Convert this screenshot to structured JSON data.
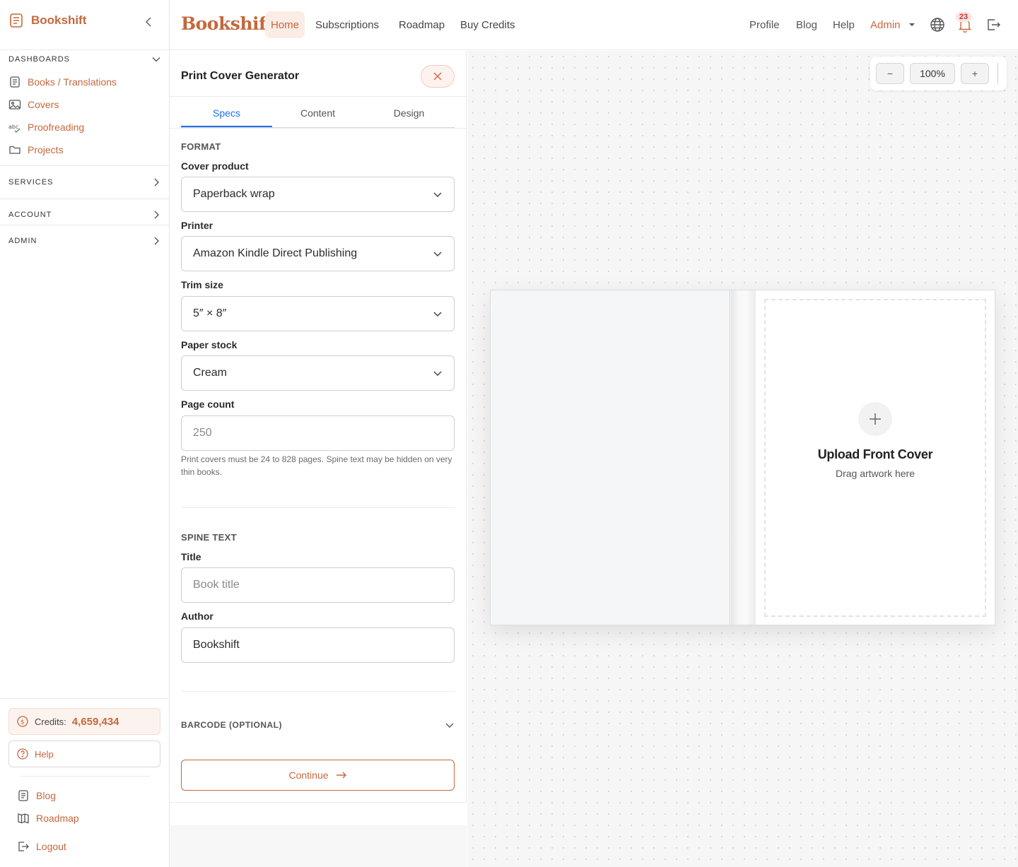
{
  "sidebar": {
    "brand": "Bookshift",
    "sections": {
      "dashboards": "DASHBOARDS",
      "services": "SERVICES",
      "account": "ACCOUNT",
      "admin": "ADMIN"
    },
    "items": [
      {
        "label": "Books / Translations",
        "icon": "book-list-icon"
      },
      {
        "label": "Covers",
        "icon": "image-icon"
      },
      {
        "label": "Proofreading",
        "icon": "spellcheck-icon"
      },
      {
        "label": "Projects",
        "icon": "folder-icon"
      }
    ],
    "credits_label": "Credits:",
    "credits_value": "4,659,434",
    "help_label": "Help",
    "bottom_links": [
      {
        "label": "Blog",
        "icon": "document-icon"
      },
      {
        "label": "Roadmap",
        "icon": "map-icon"
      },
      {
        "label": "Logout",
        "icon": "logout-icon"
      }
    ]
  },
  "topbar": {
    "brand": "Bookshift",
    "nav": [
      "Home",
      "Subscriptions",
      "Roadmap",
      "Buy Credits"
    ],
    "right": [
      "Profile",
      "Blog",
      "Help",
      "Admin"
    ],
    "notification_count": "23",
    "accent": "#c4683c"
  },
  "panel": {
    "title": "Print Cover Generator",
    "tabs": [
      "Specs",
      "Content",
      "Design"
    ],
    "active_tab": "Specs",
    "format_title": "FORMAT",
    "cover_product": {
      "label": "Cover product",
      "value": "Paperback wrap"
    },
    "printer": {
      "label": "Printer",
      "value": "Amazon Kindle Direct Publishing"
    },
    "trim_size": {
      "label": "Trim size",
      "value": "5″ × 8″"
    },
    "paper_stock": {
      "label": "Paper stock",
      "value": "Cream"
    },
    "page_count": {
      "label": "Page count",
      "placeholder": "250"
    },
    "page_hint": "Print covers must be 24 to 828 pages. Spine text may be hidden on very thin books.",
    "spine_title": "SPINE TEXT",
    "title_field": {
      "label": "Title",
      "placeholder": "Book title"
    },
    "author_field": {
      "label": "Author",
      "value": "Bookshift"
    },
    "barcode": "BARCODE (OPTIONAL)",
    "continue": "Continue"
  },
  "canvas": {
    "zoom": "100%",
    "zoom_out": "−",
    "zoom_in": "+",
    "upload_title": "Upload Front Cover",
    "upload_sub": "Drag artwork here"
  }
}
